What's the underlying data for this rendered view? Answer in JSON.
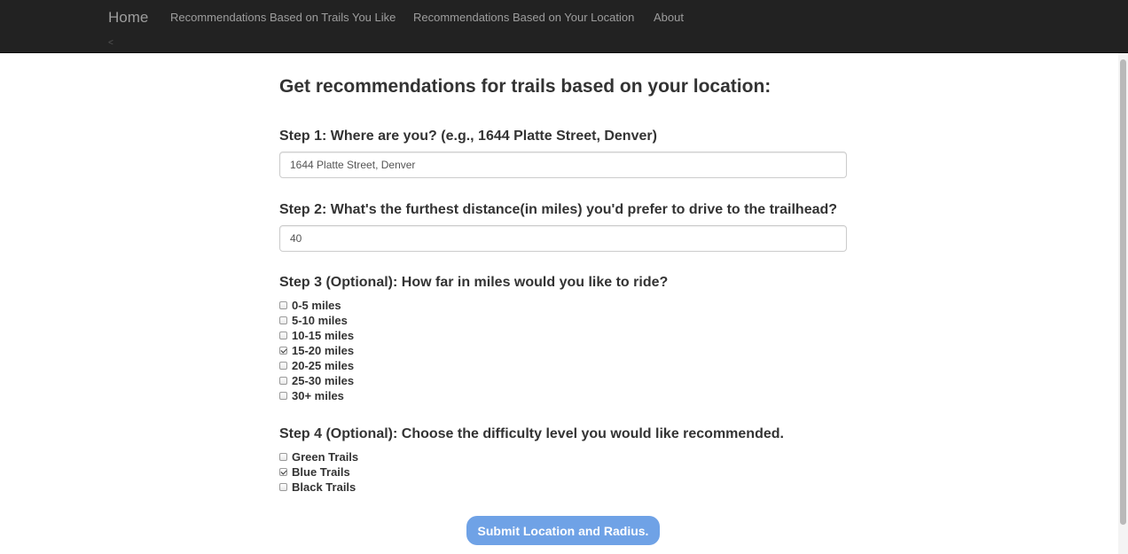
{
  "navbar": {
    "brand": "Home",
    "links": [
      "Recommendations Based on Trails You Like",
      "Recommendations Based on Your Location",
      "About"
    ],
    "caret": "<"
  },
  "main": {
    "heading": "Get recommendations for trails based on your location:",
    "step1": {
      "label": "Step 1: Where are you? (e.g., 1644 Platte Street, Denver)",
      "value": "1644 Platte Street, Denver"
    },
    "step2": {
      "label": "Step 2: What's the furthest distance(in miles) you'd prefer to drive to the trailhead?",
      "value": "40"
    },
    "step3": {
      "label": "Step 3 (Optional): How far in miles would you like to ride?",
      "options": [
        {
          "label": "0-5 miles",
          "checked": false
        },
        {
          "label": "5-10 miles",
          "checked": false
        },
        {
          "label": "10-15 miles",
          "checked": false
        },
        {
          "label": "15-20 miles",
          "checked": true
        },
        {
          "label": "20-25 miles",
          "checked": false
        },
        {
          "label": "25-30 miles",
          "checked": false
        },
        {
          "label": "30+ miles",
          "checked": false
        }
      ]
    },
    "step4": {
      "label": "Step 4 (Optional): Choose the difficulty level you would like recommended.",
      "options": [
        {
          "label": "Green Trails",
          "checked": false
        },
        {
          "label": "Blue Trails",
          "checked": true
        },
        {
          "label": "Black Trails",
          "checked": false
        }
      ]
    },
    "submit_label": "Submit Location and Radius."
  },
  "colors": {
    "navbar_bg": "#222222",
    "nav_text": "#9d9d9d",
    "button_bg": "#6fa2e6"
  }
}
